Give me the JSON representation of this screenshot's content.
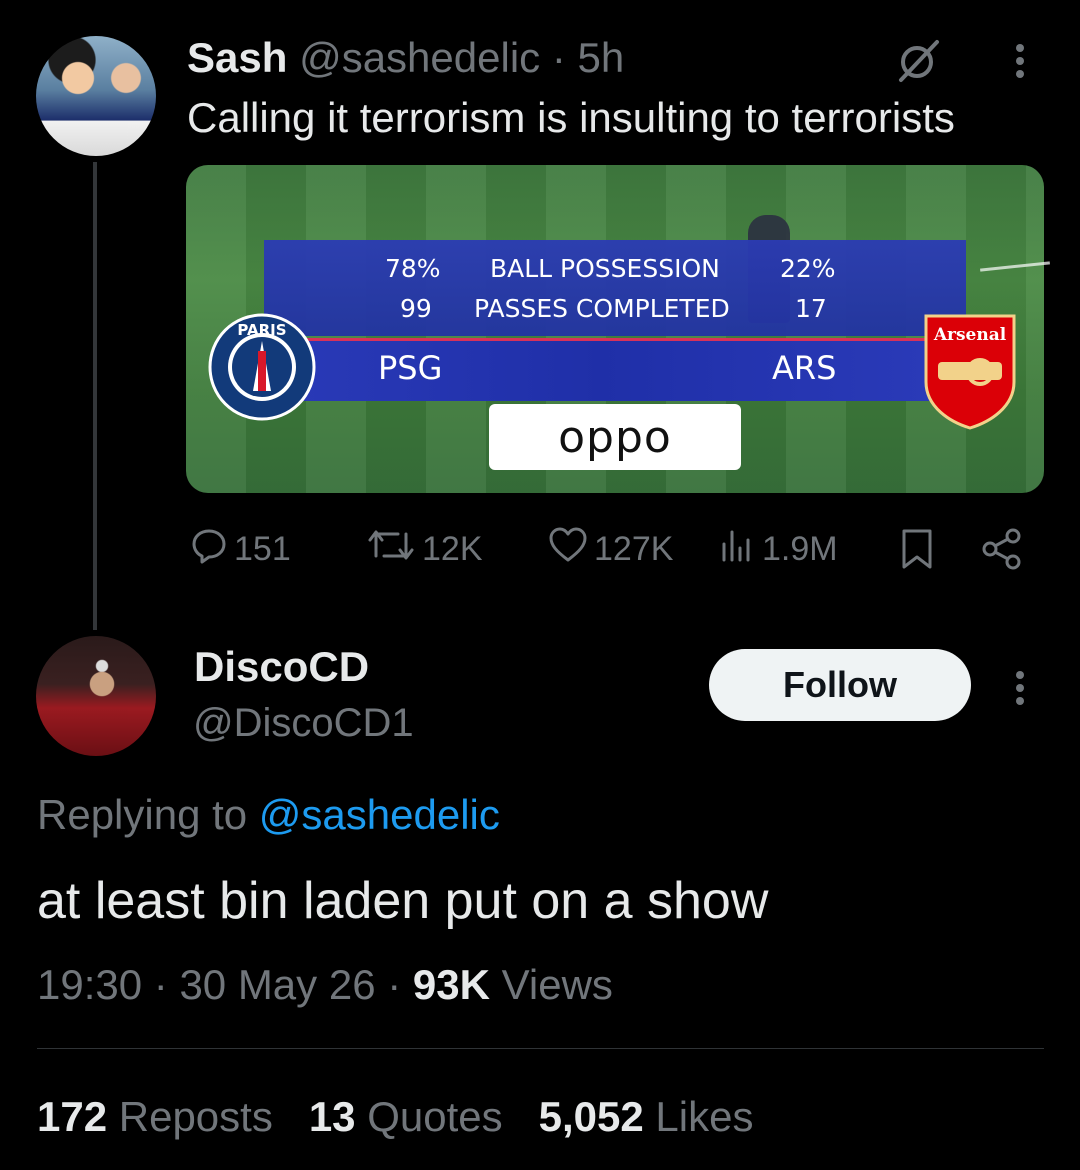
{
  "parent_tweet": {
    "name": "Sash",
    "handle": "@sashedelic",
    "separator": "·",
    "time": "5h",
    "text": "Calling it terrorism is insulting to terrorists",
    "media": {
      "stat_rows": [
        {
          "left": "78%",
          "label": "BALL POSSESSION",
          "right": "22%"
        },
        {
          "left": "99",
          "label": "PASSES COMPLETED",
          "right": "17"
        }
      ],
      "team_left": "PSG",
      "team_right": "ARS",
      "sponsor": "oppo",
      "psg_badge_text": "PARIS",
      "ars_badge_text": "Arsenal"
    },
    "actions": {
      "replies": "151",
      "reposts": "12K",
      "likes": "127K",
      "views": "1.9M"
    }
  },
  "reply_tweet": {
    "name": "DiscoCD",
    "handle": "@DiscoCD1",
    "follow_label": "Follow",
    "replying_prefix": "Replying to",
    "replying_handle": "@sashedelic",
    "text": "at least bin laden put on a show",
    "time": "19:30",
    "date": "30 May 26",
    "views_count": "93K",
    "views_label": "Views",
    "reposts_count": "172",
    "reposts_label": "Reposts",
    "quotes_count": "13",
    "quotes_label": "Quotes",
    "likes_count": "5,052",
    "likes_label": "Likes"
  },
  "colors": {
    "background": "#000000",
    "text": "#e7e9ea",
    "muted": "#71767b",
    "link": "#1d9bf0",
    "follow_bg": "#eff3f4"
  }
}
